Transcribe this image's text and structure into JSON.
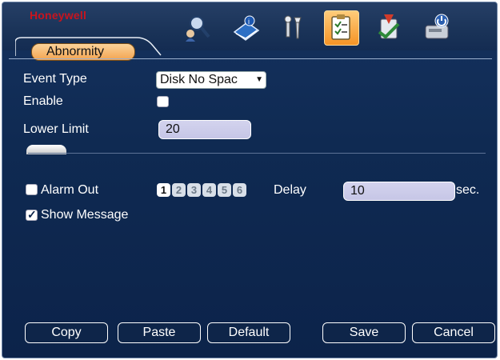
{
  "header": {
    "brand": "Honeywell",
    "tab_label": "Abnormity",
    "tools": [
      {
        "icon": "search-person-icon",
        "active": false
      },
      {
        "icon": "info-book-icon",
        "active": false
      },
      {
        "icon": "tools-icon",
        "active": false
      },
      {
        "icon": "event-clipboard-icon",
        "active": true
      },
      {
        "icon": "backup-icon",
        "active": false
      },
      {
        "icon": "disk-shutdown-icon",
        "active": false
      }
    ]
  },
  "form": {
    "event_type_label": "Event Type",
    "event_type_value": "Disk No Spac",
    "enable_label": "Enable",
    "enable_checked": false,
    "lower_limit_label": "Lower Limit",
    "lower_limit_value": "20",
    "alarm_out_label": "Alarm Out",
    "alarm_out_checked": false,
    "channels": [
      "1",
      "2",
      "3",
      "4",
      "5",
      "6"
    ],
    "active_channels": [
      "1"
    ],
    "delay_label": "Delay",
    "delay_value": "10",
    "delay_unit": "sec.",
    "show_message_label": "Show Message",
    "show_message_checked": true
  },
  "buttons": {
    "copy": "Copy",
    "paste": "Paste",
    "default": "Default",
    "save": "Save",
    "cancel": "Cancel"
  },
  "colors": {
    "background": "#0f2a52",
    "active_tab": "#f3a451",
    "brand": "#c8141e"
  }
}
